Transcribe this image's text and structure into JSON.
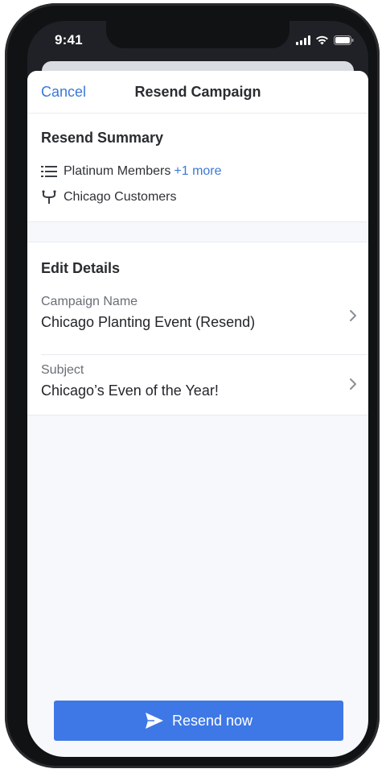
{
  "status_bar": {
    "time": "9:41",
    "icons": [
      "cellular-signal-icon",
      "wifi-icon",
      "battery-icon"
    ]
  },
  "nav": {
    "cancel_label": "Cancel",
    "title": "Resend Campaign"
  },
  "summary": {
    "title": "Resend Summary",
    "list_icon": "list-icon",
    "list_name": "Platinum Members",
    "list_more": "+1 more",
    "segment_icon": "segment-icon",
    "segment_name": "Chicago Customers"
  },
  "details": {
    "title": "Edit Details",
    "rows": [
      {
        "label": "Campaign Name",
        "value": "Chicago Planting Event (Resend)"
      },
      {
        "label": "Subject",
        "value": "Chicago’s Even of the Year!"
      }
    ]
  },
  "action": {
    "label": "Resend now",
    "icon": "send-icon"
  },
  "colors": {
    "accent": "#3d78e6",
    "link": "#3b78d8",
    "background": "#f7f8fb"
  }
}
